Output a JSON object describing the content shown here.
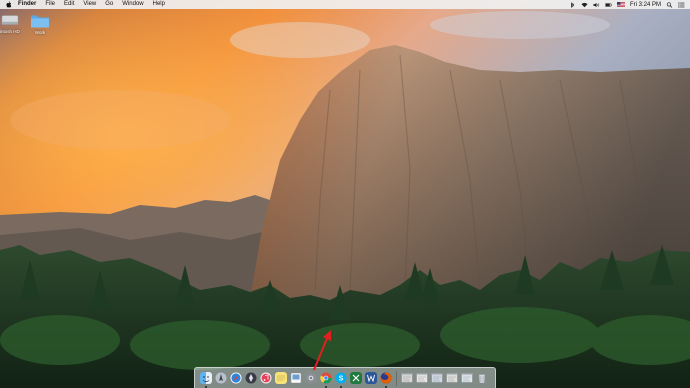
{
  "menubar": {
    "apple_icon": "apple-logo-icon",
    "items": [
      {
        "label": "Finder",
        "bold": true
      },
      {
        "label": "File"
      },
      {
        "label": "Edit"
      },
      {
        "label": "View"
      },
      {
        "label": "Go"
      },
      {
        "label": "Window"
      },
      {
        "label": "Help"
      }
    ],
    "status_icons": [
      "bluetooth-icon",
      "wifi-icon",
      "volume-icon",
      "battery-icon"
    ],
    "input_flag": "us-flag-icon",
    "clock": "Fri 3:24 PM",
    "extra_icons": [
      "spotlight-icon",
      "notification-center-icon"
    ]
  },
  "desktop": {
    "icons": [
      {
        "name": "hard-drive-icon",
        "label": "intosh HD"
      },
      {
        "name": "folder-icon",
        "label": "Work"
      }
    ]
  },
  "dock": {
    "apps": [
      {
        "name": "finder-icon",
        "color": "#3f8fd8"
      },
      {
        "name": "launchpad-icon",
        "color": "#9aa6b4"
      },
      {
        "name": "safari-icon",
        "color": "#2a7fd4"
      },
      {
        "name": "rocket-icon",
        "color": "#3a3a46"
      },
      {
        "name": "itunes-icon",
        "color": "#e8405a"
      },
      {
        "name": "notes-icon",
        "color": "#f3dd6a"
      },
      {
        "name": "preview-icon",
        "color": "#c8d6e6"
      },
      {
        "name": "system-preferences-icon",
        "color": "#7a7f87"
      },
      {
        "name": "chrome-icon",
        "color": "#dd4b39"
      },
      {
        "name": "skype-icon",
        "color": "#00aff0"
      },
      {
        "name": "excel-icon",
        "color": "#1f7a3f"
      },
      {
        "name": "word-icon",
        "color": "#2b5797"
      },
      {
        "name": "firefox-icon",
        "color": "#e66000"
      }
    ],
    "minimized": [
      {
        "name": "minimized-window-1-icon",
        "color": "#d8d8d8"
      },
      {
        "name": "minimized-window-2-icon",
        "color": "#e6e6e6"
      },
      {
        "name": "minimized-window-3-icon",
        "color": "#cfd9e6"
      },
      {
        "name": "minimized-window-4-icon",
        "color": "#e0e0e0"
      },
      {
        "name": "minimized-window-5-icon",
        "color": "#dde6ef"
      },
      {
        "name": "trash-icon",
        "color": "#c8ccd2"
      }
    ]
  },
  "annotation": {
    "arrow_color": "#e02020"
  }
}
